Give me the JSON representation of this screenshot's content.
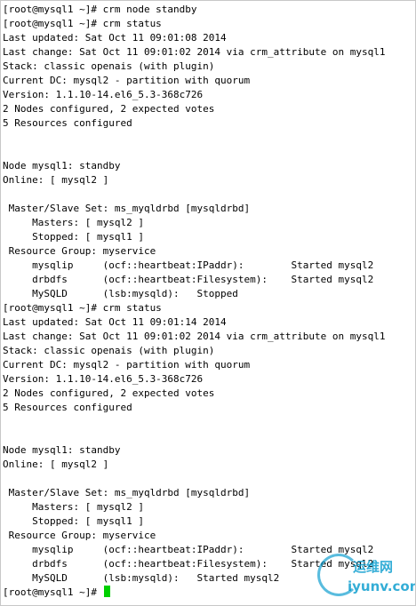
{
  "terminal": {
    "lines": [
      "[root@mysql1 ~]# crm node standby",
      "[root@mysql1 ~]# crm status",
      "Last updated: Sat Oct 11 09:01:08 2014",
      "Last change: Sat Oct 11 09:01:02 2014 via crm_attribute on mysql1",
      "Stack: classic openais (with plugin)",
      "Current DC: mysql2 - partition with quorum",
      "Version: 1.1.10-14.el6_5.3-368c726",
      "2 Nodes configured, 2 expected votes",
      "5 Resources configured",
      "",
      "",
      "Node mysql1: standby",
      "Online: [ mysql2 ]",
      "",
      " Master/Slave Set: ms_myqldrbd [mysqldrbd]",
      "     Masters: [ mysql2 ]",
      "     Stopped: [ mysql1 ]",
      " Resource Group: myservice",
      "     mysqlip     (ocf::heartbeat:IPaddr):        Started mysql2",
      "     drbdfs      (ocf::heartbeat:Filesystem):    Started mysql2",
      "     MySQLD      (lsb:mysqld):   Stopped",
      "[root@mysql1 ~]# crm status",
      "Last updated: Sat Oct 11 09:01:14 2014",
      "Last change: Sat Oct 11 09:01:02 2014 via crm_attribute on mysql1",
      "Stack: classic openais (with plugin)",
      "Current DC: mysql2 - partition with quorum",
      "Version: 1.1.10-14.el6_5.3-368c726",
      "2 Nodes configured, 2 expected votes",
      "5 Resources configured",
      "",
      "",
      "Node mysql1: standby",
      "Online: [ mysql2 ]",
      "",
      " Master/Slave Set: ms_myqldrbd [mysqldrbd]",
      "     Masters: [ mysql2 ]",
      "     Stopped: [ mysql1 ]",
      " Resource Group: myservice",
      "     mysqlip     (ocf::heartbeat:IPaddr):        Started mysql2",
      "     drbdfs      (ocf::heartbeat:Filesystem):    Started mysql2",
      "     MySQLD      (lsb:mysqld):   Started mysql2"
    ],
    "prompt": "[root@mysql1 ~]# ",
    "cursor_color": "#00d000"
  },
  "watermark": {
    "top_text": "运维网",
    "bottom_text": "iyunv.com"
  }
}
